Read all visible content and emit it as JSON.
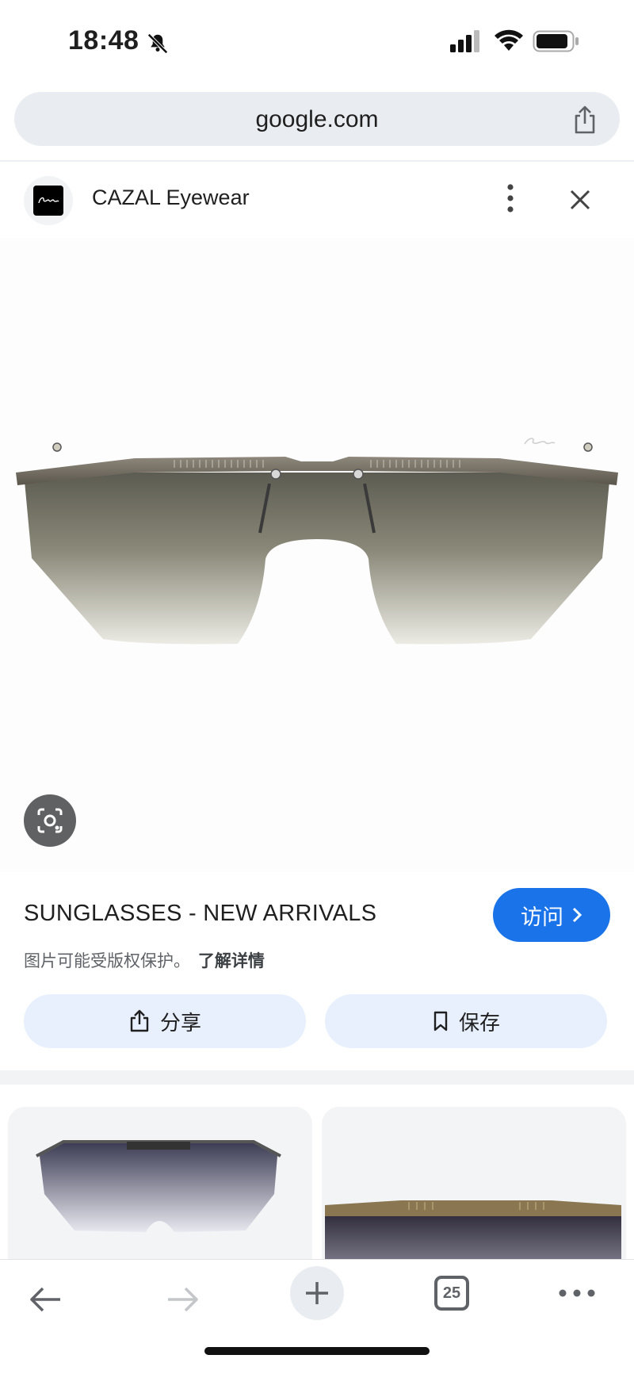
{
  "status_bar": {
    "time": "18:48"
  },
  "url_bar": {
    "domain": "google.com"
  },
  "source": {
    "name": "CAZAL Eyewear"
  },
  "result": {
    "title": "SUNGLASSES - NEW ARRIVALS",
    "visit_label": "访问",
    "copyright_notice": "图片可能受版权保护。",
    "learn_more": "了解详情",
    "share_label": "分享",
    "save_label": "保存"
  },
  "toolbar": {
    "tab_count": "25"
  },
  "colors": {
    "accent": "#1a73e8",
    "chip_bg": "#e8f0fe",
    "url_bg": "#e9edf1"
  }
}
